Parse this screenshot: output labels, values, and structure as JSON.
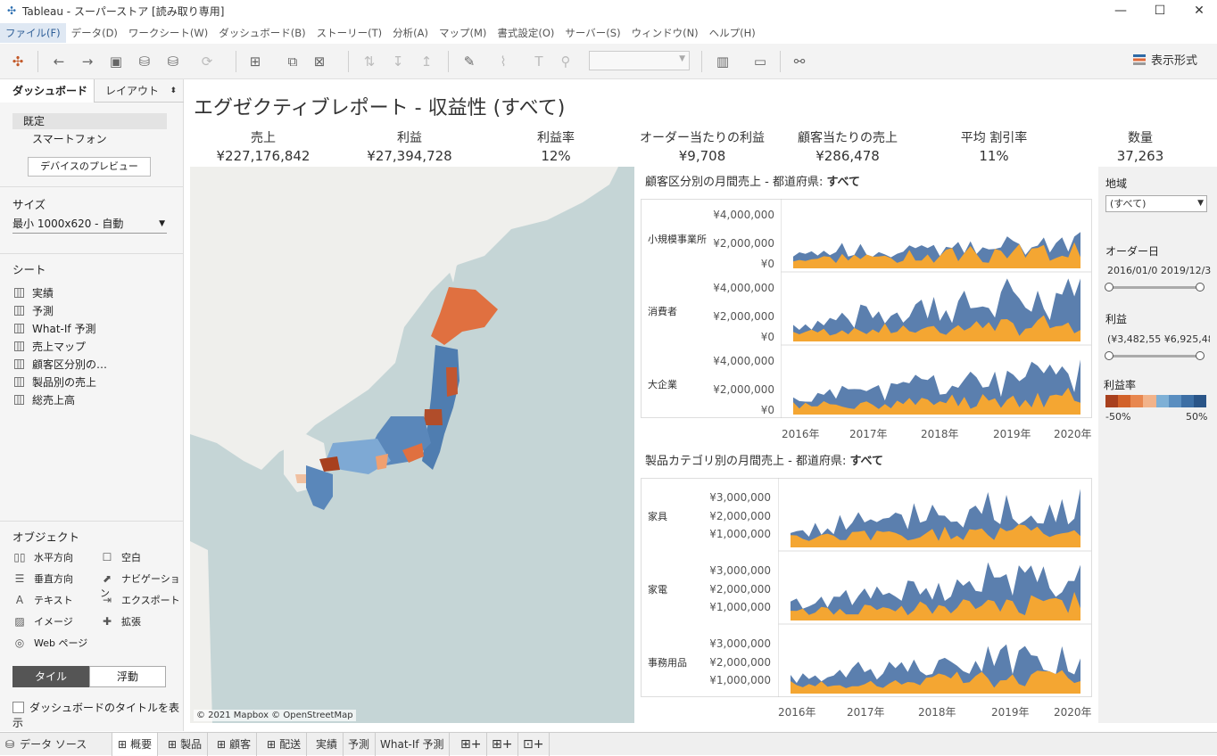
{
  "window": {
    "title": "Tableau - スーパーストア [読み取り専用]"
  },
  "menu": [
    "ファイル(F)",
    "データ(D)",
    "ワークシート(W)",
    "ダッシュボード(B)",
    "ストーリー(T)",
    "分析(A)",
    "マップ(M)",
    "書式設定(O)",
    "サーバー(S)",
    "ウィンドウ(N)",
    "ヘルプ(H)"
  ],
  "toolbar": {
    "show_me": "表示形式"
  },
  "left": {
    "tab_dashboard": "ダッシュボード",
    "tab_layout": "レイアウト",
    "device_default": "既定",
    "device_phone": "スマートフォン",
    "preview_button": "デバイスのプレビュー",
    "size_label": "サイズ",
    "size_value": "最小 1000x620 - 自動",
    "sheets_label": "シート",
    "sheets": [
      "実績",
      "予測",
      "What-If 予測",
      "売上マップ",
      "顧客区分別の…",
      "製品別の売上",
      "総売上高"
    ],
    "objects_label": "オブジェクト",
    "objects": {
      "horizontal": "水平方向",
      "blank": "空白",
      "vertical": "垂直方向",
      "navigation": "ナビゲーション",
      "text": "テキスト",
      "export": "エクスポート",
      "image": "イメージ",
      "extension": "拡張",
      "web": "Web ページ"
    },
    "tiled": "タイル",
    "floating": "浮動",
    "show_title": "ダッシュボードのタイトルを表示"
  },
  "dashboard": {
    "title": "エグゼクティブレポート - 収益性 (すべて)",
    "kpis": [
      {
        "label": "売上",
        "value": "¥227,176,842"
      },
      {
        "label": "利益",
        "value": "¥27,394,728"
      },
      {
        "label": "利益率",
        "value": "12%"
      },
      {
        "label": "オーダー当たりの利益",
        "value": "¥9,708"
      },
      {
        "label": "顧客当たりの売上",
        "value": "¥286,478"
      },
      {
        "label": "平均 割引率",
        "value": "11%"
      },
      {
        "label": "数量",
        "value": "37,263"
      }
    ],
    "map_credit": "© 2021 Mapbox © OpenStreetMap",
    "chart1_title_prefix": "顧客区分別の月間売上 - 都道府県: ",
    "chart2_title_prefix": "製品カテゴリ別の月間売上 - 都道府県: ",
    "chart_title_bold": "すべて",
    "chart1_rows": [
      "小規模事業所",
      "消費者",
      "大企業"
    ],
    "chart1_ticks": [
      "¥4,000,000",
      "¥2,000,000",
      "¥0"
    ],
    "chart2_rows": [
      "家具",
      "家電",
      "事務用品"
    ],
    "chart2_ticks": [
      "¥3,000,000",
      "¥2,000,000",
      "¥1,000,000"
    ],
    "years": [
      "2016年",
      "2017年",
      "2018年",
      "2019年",
      "2020年"
    ]
  },
  "filters": {
    "region_label": "地域",
    "region_value": "(すべて)",
    "order_date_label": "オーダー日",
    "order_date_range": "2016/01/0 2019/12/3",
    "profit_label": "利益",
    "profit_range": "(¥3,482,55 ¥6,925,48:",
    "profit_ratio_label": "利益率",
    "legend_min": "-50%",
    "legend_max": "50%",
    "legend_colors": [
      "#a8401e",
      "#d2622a",
      "#e8874f",
      "#f2b38a",
      "#7eb0d6",
      "#5a8ec0",
      "#3d6fa5",
      "#2a5588"
    ]
  },
  "bottom_tabs": [
    "データ ソース",
    "概要",
    "製品",
    "顧客",
    "配送",
    "実績",
    "予測",
    "What-If 予測"
  ],
  "colors": {
    "area_blue": "#5b7fae",
    "area_orange": "#f4a632"
  },
  "chart_data": [
    {
      "type": "area",
      "title": "顧客区分別の月間売上 - 都道府県: すべて",
      "x": [
        "2016年",
        "2017年",
        "2018年",
        "2019年",
        "2020年"
      ],
      "series": [
        {
          "name": "小規模事業所"
        },
        {
          "name": "消費者"
        },
        {
          "name": "大企業"
        }
      ],
      "ylim": [
        0,
        4000000
      ]
    },
    {
      "type": "area",
      "title": "製品カテゴリ別の月間売上 - 都道府県: すべて",
      "x": [
        "2016年",
        "2017年",
        "2018年",
        "2019年",
        "2020年"
      ],
      "series": [
        {
          "name": "家具"
        },
        {
          "name": "家電"
        },
        {
          "name": "事務用品"
        }
      ],
      "ylim": [
        0,
        3500000
      ]
    }
  ]
}
